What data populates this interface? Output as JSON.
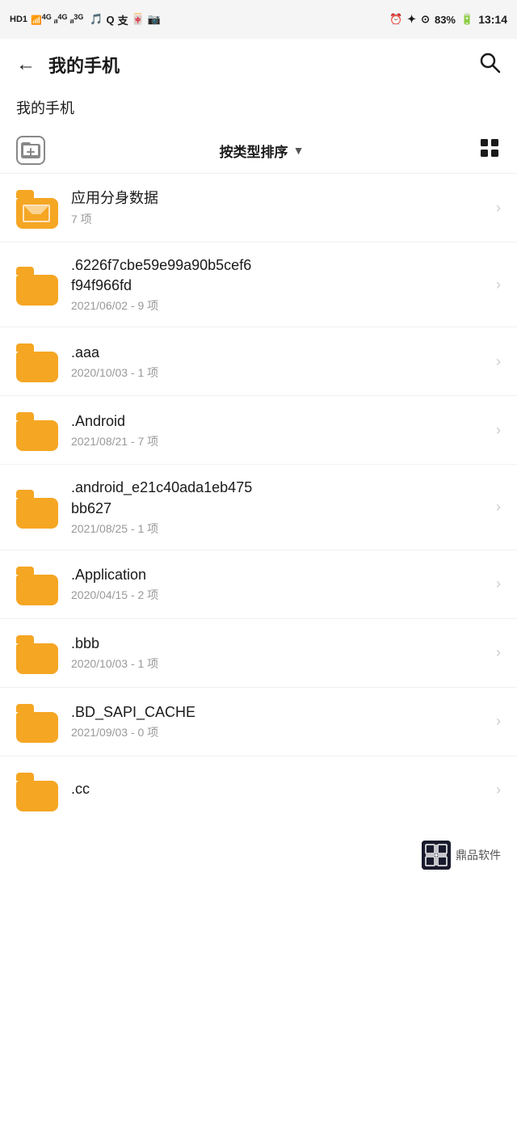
{
  "statusBar": {
    "carrier": "HD1",
    "signal": "4G",
    "signal2": "4G",
    "signal3": "3G",
    "time": "13:14",
    "battery": "83%",
    "icons": [
      "🎵",
      "Q",
      "支",
      "🀄",
      "📷"
    ]
  },
  "nav": {
    "back_label": "←",
    "title": "我的手机",
    "search_label": "🔍"
  },
  "breadcrumb": {
    "text": "我的手机"
  },
  "toolbar": {
    "sort_label": "按类型排序",
    "sort_arrow": "▼"
  },
  "folders": [
    {
      "name": "应用分身数据",
      "meta": "7 项",
      "special": true
    },
    {
      "name": ".6226f7cbe59e99a90b5cef6f94f966fd",
      "meta": "2021/06/02 - 9 项",
      "special": false
    },
    {
      "name": ".aaa",
      "meta": "2020/10/03 - 1 项",
      "special": false
    },
    {
      "name": ".Android",
      "meta": "2021/08/21 - 7 项",
      "special": false
    },
    {
      "name": ".android_e21c40ada1eb475bb627",
      "meta": "2021/08/25 - 1 项",
      "special": false
    },
    {
      "name": ".Application",
      "meta": "2020/04/15 - 2 项",
      "special": false
    },
    {
      "name": ".bbb",
      "meta": "2020/10/03 - 1 项",
      "special": false
    },
    {
      "name": ".BD_SAPI_CACHE",
      "meta": "2021/09/03 - 0 项",
      "special": false
    },
    {
      "name": ".cc",
      "meta": "",
      "special": false,
      "partial": true
    }
  ],
  "footer": {
    "logo_text": "鼎品软件",
    "logo_symbol": "品"
  }
}
